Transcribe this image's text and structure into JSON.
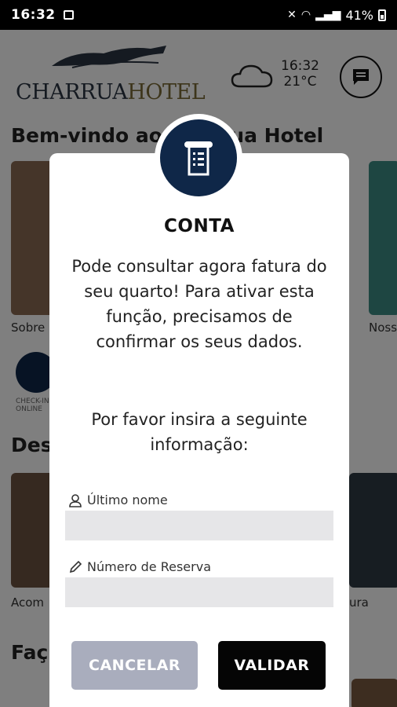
{
  "status_bar": {
    "time": "16:32",
    "battery": "41%"
  },
  "header": {
    "logo_main": "CHARRUA",
    "logo_accent": "HOTEL",
    "weather_time": "16:32",
    "weather_temp": "21°C",
    "icons": {
      "weather": "cloud-icon",
      "chat": "chat-bubble-icon"
    }
  },
  "background": {
    "welcome_title": "Bem-vindo ao Charrua Hotel",
    "cards": [
      "Sobre",
      "Noss"
    ],
    "checkin_label": "CHECK-IN ONLINE",
    "section_2": "Des",
    "cards_2": [
      "Acom",
      "ura"
    ],
    "section_3": "Faç"
  },
  "modal": {
    "icon": "receipt-icon",
    "title": "CONTA",
    "message": "Pode consultar agora fatura do seu quarto! Para ativar esta função, precisamos de confirmar os seus dados.",
    "instruction": "Por favor insira a seguinte informação:",
    "fields": {
      "last_name_label": "Último nome",
      "last_name_value": "",
      "reservation_label": "Número de Reserva",
      "reservation_value": ""
    },
    "cancel_label": "CANCELAR",
    "validate_label": "VALIDAR"
  },
  "colors": {
    "navy": "#0f2748",
    "cancel": "#a9adbd",
    "validate": "#050505"
  }
}
